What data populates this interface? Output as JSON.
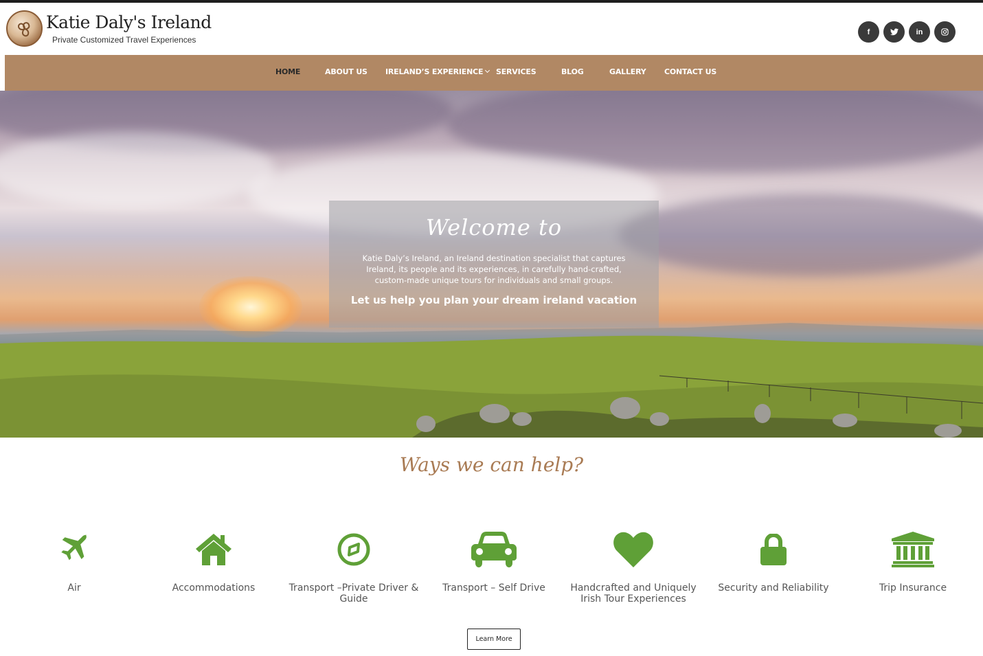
{
  "brand": {
    "title": "Katie Daly's Ireland",
    "tagline": "Private Customized Travel Experiences"
  },
  "socials": [
    {
      "icon": "facebook-icon",
      "glyph": "f"
    },
    {
      "icon": "twitter-icon",
      "glyph": "t"
    },
    {
      "icon": "linkedin-icon",
      "glyph": "in"
    },
    {
      "icon": "instagram-icon",
      "glyph": "◎"
    }
  ],
  "nav": {
    "items": [
      {
        "label": "HOME",
        "active": true
      },
      {
        "label": "ABOUT US"
      },
      {
        "label": "IRELAND’S EXPERIENCE",
        "has_dropdown": true
      },
      {
        "label": "SERVICES"
      },
      {
        "label": "BLOG"
      },
      {
        "label": "GALLERY"
      },
      {
        "label": "CONTACT US"
      }
    ]
  },
  "hero": {
    "heading": "Welcome to",
    "body": "Katie Daly’s Ireland, an Ireland destination specialist that captures Ireland, its people and its experiences, in carefully hand-crafted, custom-made unique tours for individuals and small groups.",
    "cta": "Let us help you plan your dream ireland vacation"
  },
  "ways": {
    "title": "Ways we can help?",
    "services": [
      {
        "label": "Air",
        "icon": "airplane-icon"
      },
      {
        "label": "Accommodations",
        "icon": "home-icon"
      },
      {
        "label": "Transport –Private Driver & Guide",
        "icon": "compass-icon"
      },
      {
        "label": "Transport – Self Drive",
        "icon": "car-icon"
      },
      {
        "label": "Handcrafted and Uniquely Irish Tour Experiences",
        "icon": "heart-icon"
      },
      {
        "label": "Security and Reliability",
        "icon": "lock-icon"
      },
      {
        "label": "Trip Insurance",
        "icon": "bank-icon"
      }
    ],
    "learn_more": "Learn More"
  },
  "colors": {
    "nav_bg": "#b18864",
    "icon_green": "#5fa037",
    "accent_brown": "#a97b54"
  }
}
